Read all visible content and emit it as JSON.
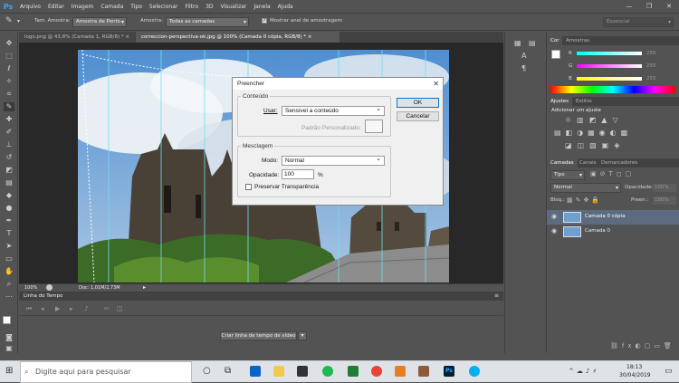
{
  "menu": {
    "logo": "Ps",
    "items": [
      "Arquivo",
      "Editar",
      "Imagem",
      "Camada",
      "Tipo",
      "Selecionar",
      "Filtro",
      "3D",
      "Visualizar",
      "Janela",
      "Ajuda"
    ]
  },
  "options": {
    "tam_label": "Tam. Amostra:",
    "tam_value": "Amostra de Ponto",
    "amostra_label": "Amostra:",
    "amostra_value": "Todas as camadas",
    "ring_label": "Mostrar anel de amostragem",
    "workspace": "Essencial"
  },
  "tabs": [
    {
      "label": "logo.png @ 43,8% (Camada 1, RGB/8) *"
    },
    {
      "label": "correccion-perspectiva-ok.jpg @ 100% (Camada 0 cópia, RGB/8) *"
    }
  ],
  "status": {
    "zoom": "100%",
    "doc": "Doc: 1,01M/2,73M"
  },
  "timeline": {
    "title": "Linha do Tempo",
    "create_button": "Criar linha de tempo de vídeo"
  },
  "color_panel": {
    "tabs": [
      "Cor",
      "Amostras"
    ],
    "r_label": "R",
    "g_label": "G",
    "b_label": "B",
    "r_value": "255",
    "g_value": "255",
    "b_value": "255"
  },
  "adjust_panel": {
    "tabs": [
      "Ajustes",
      "Estilos"
    ],
    "title": "Adicionar um ajuste"
  },
  "layers_panel": {
    "tabs": [
      "Camadas",
      "Canais",
      "Demarcadores"
    ],
    "kind": "Tipo",
    "blend": "Normal",
    "opacity_label": "Opacidade:",
    "opacity_value": "100%",
    "lock_label": "Bloq.:",
    "fill_label": "Preen.:",
    "fill_value": "100%",
    "layers": [
      {
        "name": "Camada 0 cópia"
      },
      {
        "name": "Camada 0"
      }
    ]
  },
  "dialog": {
    "title": "Preencher",
    "content_legend": "Conteúdo",
    "use_label": "Usar:",
    "use_value": "Sensível a conteúdo",
    "pattern_label": "Padrão Personalizado:",
    "blend_legend": "Mesclagem",
    "mode_label": "Modo:",
    "mode_value": "Normal",
    "opacity_label": "Opacidade:",
    "opacity_value": "100",
    "opacity_unit": "%",
    "preserve_label": "Preservar Transparência",
    "ok": "OK",
    "cancel": "Cancelar"
  },
  "taskbar": {
    "search_placeholder": "Digite aqui para pesquisar",
    "time": "18:13",
    "date": "30/04/2019"
  }
}
